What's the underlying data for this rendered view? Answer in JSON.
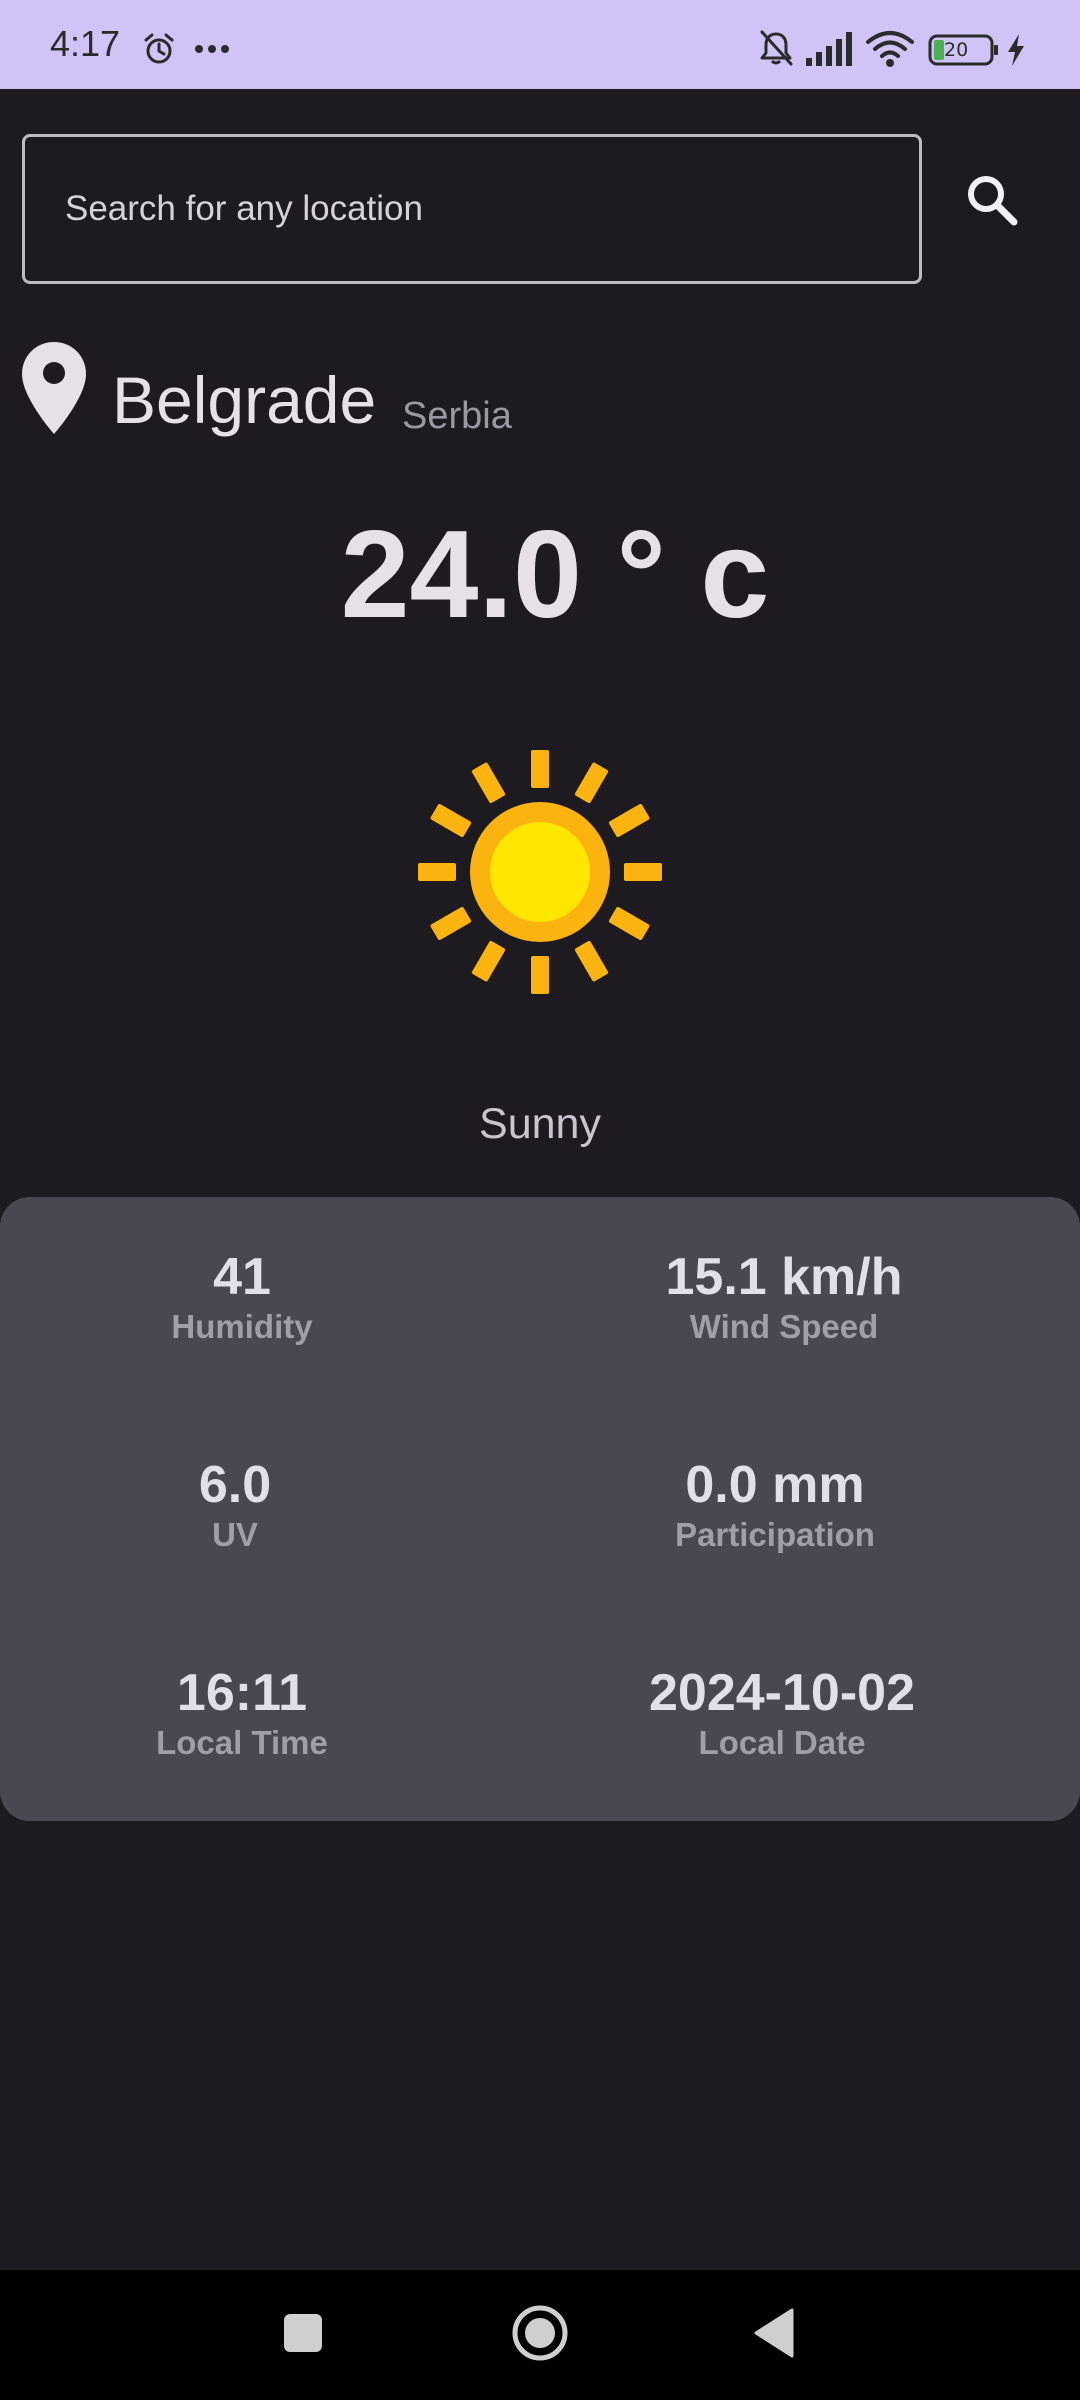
{
  "status_bar": {
    "time": "4:17",
    "battery_level": "20",
    "icons": [
      "alarm-icon",
      "more-dots-icon",
      "mute-bell-icon",
      "signal-icon",
      "wifi-icon",
      "battery-icon",
      "charging-icon"
    ]
  },
  "search": {
    "placeholder": "Search for any location",
    "value": "",
    "icon": "search-icon"
  },
  "location": {
    "icon": "location-pin-icon",
    "city": "Belgrade",
    "country": "Serbia"
  },
  "weather": {
    "temperature": "24.0 ° c",
    "condition_icon": "sun-icon",
    "condition": "Sunny"
  },
  "details": [
    {
      "value": "41",
      "label": "Humidity"
    },
    {
      "value": "15.1 km/h",
      "label": "Wind Speed"
    },
    {
      "value": "6.0",
      "label": "UV"
    },
    {
      "value": "0.0 mm",
      "label": "Participation"
    },
    {
      "value": "16:11",
      "label": "Local Time"
    },
    {
      "value": "2024-10-02",
      "label": "Local Date"
    }
  ],
  "nav_bar": {
    "icons": [
      "recents-square-icon",
      "home-circle-icon",
      "back-triangle-icon"
    ]
  },
  "colors": {
    "status_bar_bg": "#d0c4f7",
    "background": "#1d1b20",
    "card": "#4a4751",
    "sun_outer": "#fbb40f",
    "sun_inner": "#ffe600"
  }
}
